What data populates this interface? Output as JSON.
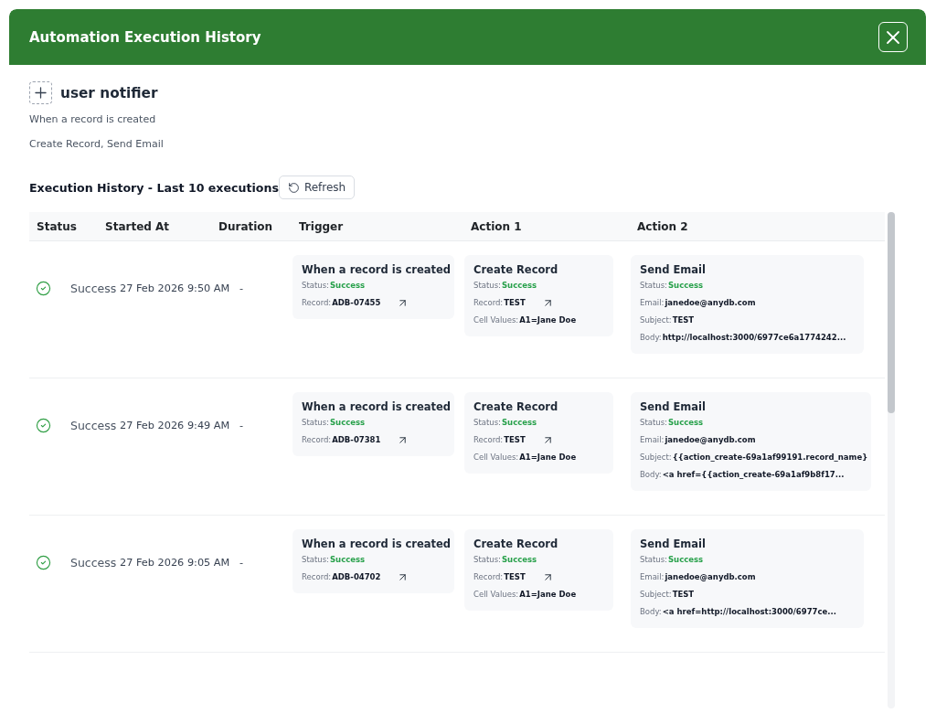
{
  "dialog": {
    "title": "Automation Execution History"
  },
  "automation": {
    "name": "user notifier",
    "trigger": "When a record is created",
    "actions": "Create Record, Send Email"
  },
  "history": {
    "title": "Execution History - Last 10 executions",
    "refresh_label": "Refresh"
  },
  "table": {
    "columns": [
      "Status",
      "Started At",
      "Duration",
      "Trigger",
      "Action 1",
      "Action 2"
    ],
    "rows": [
      {
        "status": {
          "kind": "success",
          "label": "Success"
        },
        "started_at": "27 Feb 2026 9:50 AM",
        "duration": "-",
        "steps": [
          {
            "title": "When a record is created",
            "fields": [
              {
                "kind": "status",
                "label": "Status:",
                "value": "Success"
              },
              {
                "kind": "link",
                "label": "Record:",
                "value": "ADB-07455"
              }
            ]
          },
          {
            "title": "Create Record",
            "fields": [
              {
                "kind": "status",
                "label": "Status:",
                "value": "Success"
              },
              {
                "kind": "link",
                "label": "Record:",
                "value": "TEST"
              },
              {
                "kind": "text",
                "label": "Cell Values:",
                "value": "A1=Jane Doe"
              }
            ]
          },
          {
            "title": "Send Email",
            "fields": [
              {
                "kind": "status",
                "label": "Status:",
                "value": "Success"
              },
              {
                "kind": "text",
                "label": "Email:",
                "value": "janedoe@anydb.com"
              },
              {
                "kind": "text",
                "label": "Subject:",
                "value": "TEST"
              },
              {
                "kind": "text",
                "label": "Body:",
                "value": "http://localhost:3000/6977ce6a1774242..."
              }
            ]
          }
        ]
      },
      {
        "status": {
          "kind": "success",
          "label": "Success"
        },
        "started_at": "27 Feb 2026 9:49 AM",
        "duration": "-",
        "steps": [
          {
            "title": "When a record is created",
            "fields": [
              {
                "kind": "status",
                "label": "Status:",
                "value": "Success"
              },
              {
                "kind": "link",
                "label": "Record:",
                "value": "ADB-07381"
              }
            ]
          },
          {
            "title": "Create Record",
            "fields": [
              {
                "kind": "status",
                "label": "Status:",
                "value": "Success"
              },
              {
                "kind": "link",
                "label": "Record:",
                "value": "TEST"
              },
              {
                "kind": "text",
                "label": "Cell Values:",
                "value": "A1=Jane Doe"
              }
            ]
          },
          {
            "title": "Send Email",
            "fields": [
              {
                "kind": "status",
                "label": "Status:",
                "value": "Success"
              },
              {
                "kind": "text",
                "label": "Email:",
                "value": "janedoe@anydb.com"
              },
              {
                "kind": "text",
                "label": "Subject:",
                "value": "{{action_create-69a1af99191.record_name}"
              },
              {
                "kind": "text",
                "label": "Body:",
                "value": "<a href={{action_create-69a1af9b8f17..."
              }
            ]
          }
        ]
      },
      {
        "status": {
          "kind": "success",
          "label": "Success"
        },
        "started_at": "27 Feb 2026 9:05 AM",
        "duration": "-",
        "steps": [
          {
            "title": "When a record is created",
            "fields": [
              {
                "kind": "status",
                "label": "Status:",
                "value": "Success"
              },
              {
                "kind": "link",
                "label": "Record:",
                "value": "ADB-04702"
              }
            ]
          },
          {
            "title": "Create Record",
            "fields": [
              {
                "kind": "status",
                "label": "Status:",
                "value": "Success"
              },
              {
                "kind": "link",
                "label": "Record:",
                "value": "TEST"
              },
              {
                "kind": "text",
                "label": "Cell Values:",
                "value": "A1=Jane Doe"
              }
            ]
          },
          {
            "title": "Send Email",
            "fields": [
              {
                "kind": "status",
                "label": "Status:",
                "value": "Success"
              },
              {
                "kind": "text",
                "label": "Email:",
                "value": "janedoe@anydb.com"
              },
              {
                "kind": "text",
                "label": "Subject:",
                "value": "TEST"
              },
              {
                "kind": "text",
                "label": "Body:",
                "value": "<a href=http://localhost:3000/6977ce..."
              }
            ]
          }
        ]
      }
    ]
  }
}
